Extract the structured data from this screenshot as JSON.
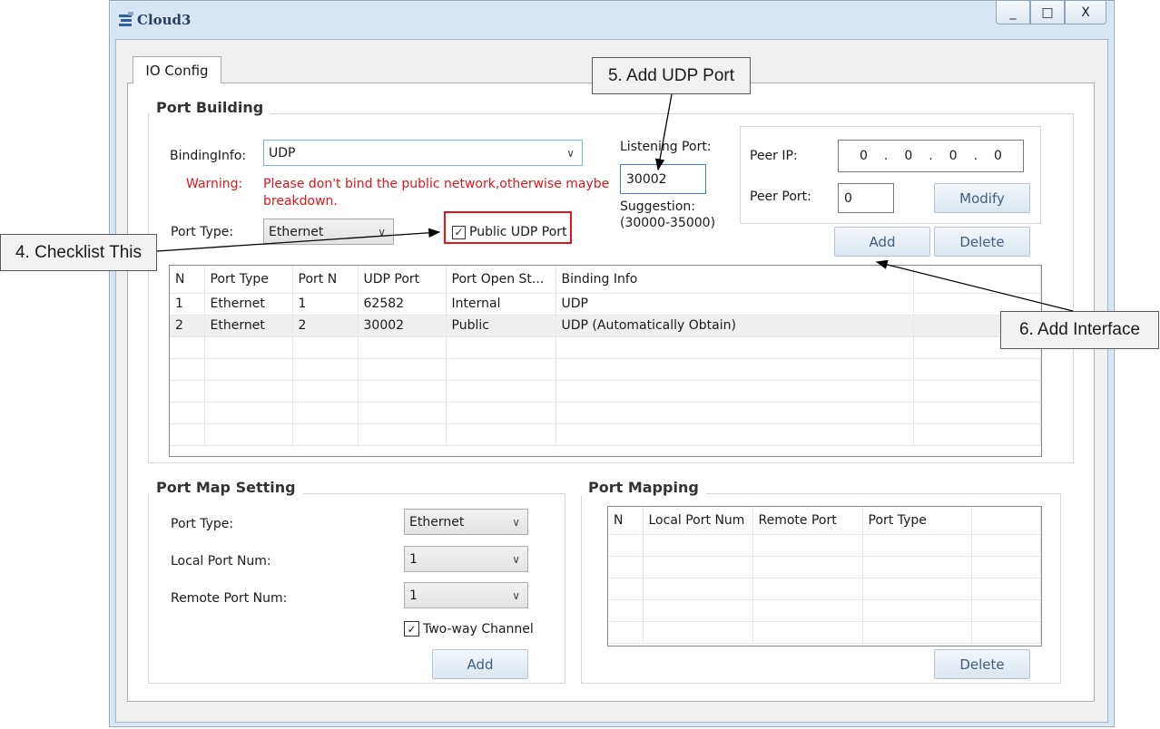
{
  "window": {
    "title": "Cloud3",
    "min_label": "_",
    "max_label": "□",
    "close_label": "X"
  },
  "tabs": [
    {
      "label": "IO Config"
    }
  ],
  "port_building": {
    "title": "Port Building",
    "binding_info_label": "BindingInfo:",
    "binding_info_value": "UDP",
    "warning_label": "Warning:",
    "warning_text_1": "Please don't bind the public network,otherwise maybe",
    "warning_text_2": "breakdown.",
    "port_type_label": "Port Type:",
    "port_type_value": "Ethernet",
    "public_udp_label": "Public UDP Port",
    "public_udp_checked": true,
    "listening_port_label": "Listening Port:",
    "listening_port_value": "30002",
    "suggestion_label": "Suggestion:",
    "suggestion_range": "(30000-35000)",
    "peer_ip_label": "Peer IP:",
    "peer_ip_octets": [
      "0",
      "0",
      "0",
      "0"
    ],
    "peer_port_label": "Peer Port:",
    "peer_port_value": "0",
    "modify_label": "Modify",
    "add_label": "Add",
    "delete_label": "Delete",
    "table": {
      "columns": [
        "N",
        "Port Type",
        "Port N",
        "UDP Port",
        "Port Open St...",
        "Binding Info"
      ],
      "rows": [
        [
          "1",
          "Ethernet",
          "1",
          "62582",
          "Internal",
          "UDP"
        ],
        [
          "2",
          "Ethernet",
          "2",
          "30002",
          "Public",
          "UDP (Automatically Obtain)"
        ]
      ]
    }
  },
  "port_map_setting": {
    "title": "Port Map Setting",
    "port_type_label": "Port Type:",
    "port_type_value": "Ethernet",
    "local_port_label": "Local Port Num:",
    "local_port_value": "1",
    "remote_port_label": "Remote Port Num:",
    "remote_port_value": "1",
    "two_way_label": "Two-way Channel",
    "two_way_checked": true,
    "add_label": "Add"
  },
  "port_mapping": {
    "title": "Port Mapping",
    "columns": [
      "N",
      "Local Port Num",
      "Remote Port",
      "Port Type"
    ],
    "delete_label": "Delete"
  },
  "annotations": {
    "step4": "4. Checklist This",
    "step5": "5. Add UDP Port",
    "step6": "6. Add Interface"
  },
  "colors": {
    "annotation_red": "#e3141b",
    "button_text": "#3b5f86",
    "window_frame": "#d8e6f3"
  }
}
